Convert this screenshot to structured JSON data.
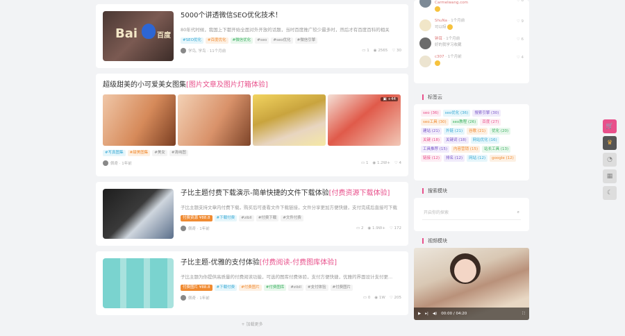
{
  "posts": [
    {
      "title": "5000个讲透微信SEO优化技术！",
      "excerpt": "80年代时候，我国上下都开始全面对外开放的话题，当时百度推广较少最多时，然后才有百度百科的相关",
      "tags": [
        "#SEO优化",
        "#百度优化",
        "#微信优化",
        "#seo",
        "#seo优化",
        "#微信引擎"
      ],
      "author": "学鸟, 学鸟 · 11个月前",
      "stats": [
        "1",
        "2565",
        "30"
      ],
      "thumb_text": "Bai百度"
    },
    {
      "title_prefix": "超级甜美的小可爱美女图集",
      "title_hl": "[图片文章及图片灯箱体验]",
      "tags": [
        "#写真图集",
        "#甜美图集",
        "#美女",
        "#清纯图"
      ],
      "author": "佩奇 · 1年前",
      "stats": [
        "1",
        "1.2W+",
        "4"
      ],
      "count_badge": "+44"
    },
    {
      "title_prefix": "子比主题付费下载演示-简单快捷的文件下载体验",
      "title_hl": "[付费资源下载体验]",
      "excerpt": "子比主题支持文章内付费下载，购买后可查看文件下载链接，文件分享更加方便快捷，支付完成后直接可下载",
      "tags": [
        "付费资源 ¥88.8",
        "#下载付费",
        "#zibll",
        "#付费下载",
        "#文件付费"
      ],
      "author": "佩奇 · 1年前",
      "stats": [
        "2",
        "1.9W+",
        "172"
      ]
    },
    {
      "title_prefix": "子比主题-优雅的支付体验",
      "title_hl": "[付费阅读-付费图库体验]",
      "excerpt": "子比主题为你提供高质量的付费阅读功能，可选的图库付费体验，支付方便快捷，优雅的界面设计支付更...",
      "tags": [
        "付费图片 ¥88.8",
        "#下载付费",
        "#付费图片",
        "#付费图库",
        "#zibll",
        "#支付体验",
        "#付费图片"
      ],
      "author": "佩奇 · 1年前",
      "stats": [
        "0",
        "1W",
        "205"
      ]
    }
  ],
  "load_more": "加载更多",
  "comments": [
    {
      "name": "Carmelwang.com",
      "time": "",
      "text": "",
      "likes": "6"
    },
    {
      "name": "ShuNa",
      "time": "· 1个月前",
      "text": "可以呀",
      "likes": "9"
    },
    {
      "name": "钟耳",
      "time": "· 1个月前",
      "text": "好的我学习收藏",
      "likes": "6"
    },
    {
      "name": "c307",
      "time": "· 1个月前",
      "text": "",
      "likes": "4"
    }
  ],
  "sections": {
    "tags_title": "标签云",
    "search_title": "搜索模块",
    "video_title": "视频模块"
  },
  "tag_cloud": [
    {
      "t": "seo (36)",
      "c": "#e8508b",
      "bg": "#fdeef4"
    },
    {
      "t": "seo优化 (36)",
      "c": "#3aa9d4",
      "bg": "#e6f6fb"
    },
    {
      "t": "搜索引擎 (30)",
      "c": "#7a58c8",
      "bg": "#f1ecfb"
    },
    {
      "t": "seo工具 (30)",
      "c": "#f08b32",
      "bg": "#fdf0e3"
    },
    {
      "t": "seo教程 (26)",
      "c": "#3db162",
      "bg": "#e8f7ec"
    },
    {
      "t": "百度 (27)",
      "c": "#e8508b",
      "bg": "#fdeef4"
    },
    {
      "t": "建站 (21)",
      "c": "#7a58c8",
      "bg": "#f1ecfb"
    },
    {
      "t": "外链 (21)",
      "c": "#3aa9d4",
      "bg": "#e6f6fb"
    },
    {
      "t": "谷歌 (21)",
      "c": "#f08b32",
      "bg": "#fdf0e3"
    },
    {
      "t": "优化 (20)",
      "c": "#3db162",
      "bg": "#e8f7ec"
    },
    {
      "t": "关键 (18)",
      "c": "#e8508b",
      "bg": "#fdeef4"
    },
    {
      "t": "关键词 (18)",
      "c": "#7a58c8",
      "bg": "#f1ecfb"
    },
    {
      "t": "网站优化 (16)",
      "c": "#3aa9d4",
      "bg": "#e6f6fb"
    },
    {
      "t": "工具推荐 (15)",
      "c": "#7a58c8",
      "bg": "#f1ecfb"
    },
    {
      "t": "内容营销 (15)",
      "c": "#f08b32",
      "bg": "#fdf0e3"
    },
    {
      "t": "站长工具 (13)",
      "c": "#3db162",
      "bg": "#e8f7ec"
    },
    {
      "t": "链接 (12)",
      "c": "#e8508b",
      "bg": "#fdeef4"
    },
    {
      "t": "排名 (12)",
      "c": "#7a58c8",
      "bg": "#f1ecfb"
    },
    {
      "t": "网站 (12)",
      "c": "#3aa9d4",
      "bg": "#e6f6fb"
    },
    {
      "t": "google (12)",
      "c": "#f08b32",
      "bg": "#fdf0e3"
    }
  ],
  "search": {
    "placeholder": "开启你的探索"
  },
  "video": {
    "time": "00:00 / 04:20"
  },
  "colors": {
    "accent": "#e8508b",
    "bg": "#f2f3f5"
  }
}
